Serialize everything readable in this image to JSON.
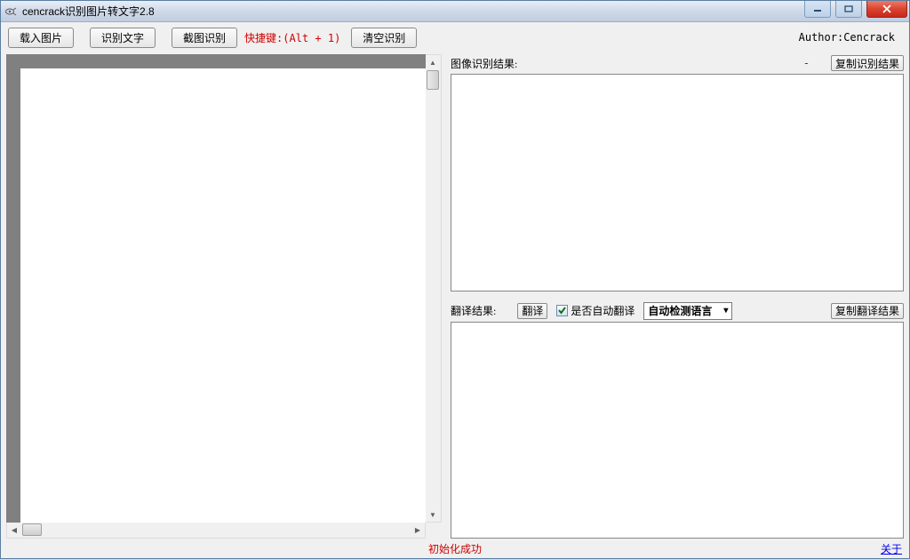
{
  "window": {
    "title": "cencrack识别图片转文字2.8"
  },
  "toolbar": {
    "load_image_label": "载入图片",
    "recognize_text_label": "识别文字",
    "screenshot_recognize_label": "截图识别",
    "shortcut_label": "快捷键:(Alt + 1)",
    "clear_label": "清空识别",
    "author_label": "Author:Cencrack"
  },
  "recognition": {
    "title": "图像识别结果:",
    "status": "-",
    "copy_label": "复制识别结果",
    "text": ""
  },
  "translation": {
    "title": "翻译结果:",
    "translate_button": "翻译",
    "auto_translate_label": "是否自动翻译",
    "auto_translate_checked": true,
    "language_combo": "自动检测语言",
    "copy_label": "复制翻译结果",
    "text": ""
  },
  "status": {
    "message": "初始化成功",
    "about": "关于"
  },
  "icons": {
    "app": "app-icon",
    "minimize": "minimize-icon",
    "maximize": "maximize-icon",
    "close": "close-icon",
    "checkmark": "checkmark-icon",
    "dropdown": "chevron-down-icon"
  }
}
